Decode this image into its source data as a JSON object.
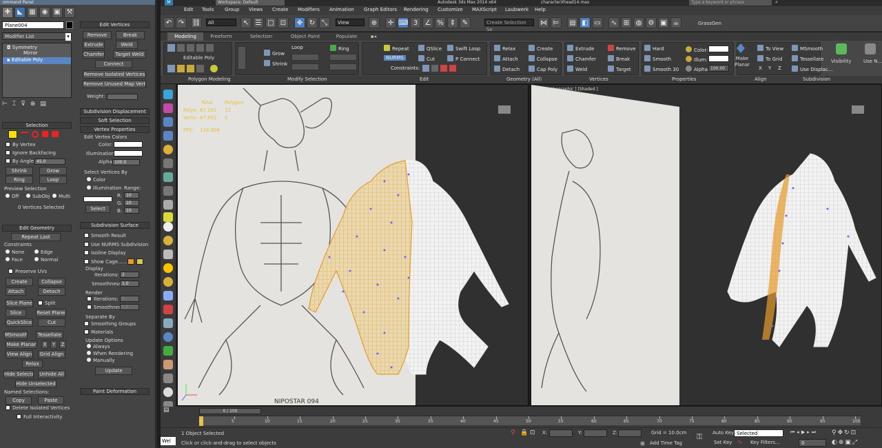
{
  "app": {
    "title": "Autodesk 3ds Max  2014 x64",
    "workspace": "Workspace: Default",
    "file": "characterXhead14.max",
    "search_placeholder": "Type a keyword or phrase"
  },
  "menubar": [
    "Edit",
    "Tools",
    "Group",
    "Views",
    "Create",
    "Modifiers",
    "Animation",
    "Graph Editors",
    "Rendering",
    "Customize",
    "MAXScript",
    "Laubwerk",
    "Help"
  ],
  "cmdpanel": {
    "title": "ommand Panel",
    "object_name": "Plane004",
    "modifier_list": "Modifier List",
    "stack": [
      "Symmetry",
      "Mirror",
      "Editable Poly"
    ],
    "edit_vertices": {
      "header": "Edit Vertices",
      "remove": "Remove",
      "break": "Break",
      "extrude": "Extrude",
      "weld": "Weld",
      "chamfer": "Chamfer",
      "target_weld": "Target Weld",
      "connect": "Connect",
      "remove_isolated": "Remove Isolated Vertices",
      "remove_unused": "Remove Unused Map Verts",
      "weight": "Weight:"
    },
    "subdiv_displacement": "Subdivision Displacement",
    "soft_selection": "Soft Selection",
    "vertex_props": {
      "header": "Vertex Properties",
      "edit_colors": "Edit Vertex Colors",
      "color": "Color:",
      "illumination": "Illumination:",
      "alpha": "Alpha:",
      "alpha_val": "100.0",
      "select_by": "Select Vertices By",
      "opt_color": "Color",
      "opt_illum": "Illumination",
      "range": "Range:",
      "r": "R:",
      "g": "G:",
      "b": "B:",
      "r_val": "10",
      "g_val": "10",
      "b_val": "10",
      "select": "Select"
    },
    "subdiv_surface": {
      "header": "Subdivision Surface",
      "smooth_result": "Smooth Result",
      "use_nurms": "Use NURMS Subdivision",
      "isoline": "Isoline Display",
      "show_cage": "Show Cage......",
      "display": "Display",
      "iterations": "Iterations:",
      "iter_val": "2",
      "smoothness": "Smoothness:",
      "smooth_val": "1.0",
      "render": "Render",
      "r_iterations": "Iterations:",
      "r_iter_val": "0",
      "r_smoothness": "Smoothness:",
      "r_smooth_val": "1.0",
      "separate_by": "Separate By",
      "smoothing_groups": "Smoothing Groups",
      "materials": "Materials",
      "update_options": "Update Options",
      "always": "Always",
      "when_rendering": "When Rendering",
      "manually": "Manually",
      "update": "Update"
    },
    "paint_deformation": "Paint Deformation",
    "selection": {
      "header": "Selection",
      "by_vertex": "By Vertex",
      "ignore_backfacing": "Ignore Backfacing",
      "by_angle": "By Angle:",
      "angle_val": "45.0",
      "shrink": "Shrink",
      "grow": "Grow",
      "ring": "Ring",
      "loop": "Loop",
      "preview": "Preview Selection",
      "off": "Off",
      "subobj": "SubObj",
      "multi": "Multi",
      "status": "0 Vertices Selected"
    },
    "edit_geometry": {
      "header": "Edit Geometry",
      "repeat_last": "Repeat Last",
      "constraints": "Constraints",
      "none": "None",
      "edge": "Edge",
      "face": "Face",
      "normal": "Normal",
      "preserve_uvs": "Preserve UVs",
      "create": "Create",
      "collapse": "Collapse",
      "attach": "Attach",
      "detach": "Detach",
      "slice_plane": "Slice Plane",
      "split": "Split",
      "slice": "Slice",
      "reset_plane": "Reset Plane",
      "quickslice": "QuickSlice",
      "cut": "Cut",
      "msmooth": "MSmooth",
      "tessellate": "Tessellate",
      "make_planar": "Make Planar",
      "x": "X",
      "y": "Y",
      "z": "Z",
      "view_align": "View Align",
      "grid_align": "Grid Align",
      "relax": "Relax",
      "hide_selected": "Hide Selected",
      "unhide_all": "Unhide All",
      "hide_unselected": "Hide Unselected",
      "named_sel": "Named Selections:",
      "copy": "Copy",
      "paste": "Paste",
      "delete_isolated": "Delete Isolated Vertices",
      "full_interactivity": "Full Interactivity"
    }
  },
  "maintool": {
    "filter": "All",
    "refcoord": "View",
    "selset": "Create Selection Se",
    "grassgen": "GrassGen"
  },
  "ribbon_tabs": [
    "Modeling",
    "Freeform",
    "Selection",
    "Object Paint",
    "Populate"
  ],
  "ribbon": {
    "editable_poly": "Editable Poly",
    "grow": "Grow",
    "shrink": "Shrink",
    "loop": "Loop",
    "ring": "Ring",
    "repeat": "Repeat",
    "qslice": "QSlice",
    "swift_loop": "Swift Loop",
    "nurms": "NURMS",
    "cut": "Cut",
    "p_connect": "P Connect",
    "constraints": "Constraints:",
    "relax": "Relax",
    "create": "Create",
    "attach": "Attach",
    "collapse": "Collapse",
    "detach": "Detach",
    "cap_poly": "Cap Poly",
    "extrude": "Extrude",
    "remove": "Remove",
    "chamfer": "Chamfer",
    "break": "Break",
    "weld": "Weld",
    "target": "Target",
    "hard": "Hard",
    "smooth": "Smooth",
    "smooth30": "Smooth 30",
    "color": "Color:",
    "illum": "Illum:",
    "alpha": "Alpha:",
    "alpha_val": "100.00",
    "make_planar": "Make Planar",
    "to_view": "To View",
    "to_grid": "To Grid",
    "x": "X",
    "y": "Y",
    "z": "Z",
    "msmooth": "MSmooth",
    "tessellate": "Tessellate",
    "use_displace": "Use Displac...",
    "visibility": "Visibility",
    "use_n": "Use N...",
    "groups": [
      "Polygon Modeling",
      "Modify Selection",
      "Edit",
      "Geometry (All)",
      "Vertices",
      "Properties",
      "Align",
      "Subdivision"
    ]
  },
  "vp1": {
    "stats": {
      "total": "Total",
      "polys_l": "Polys:",
      "polys_v": "67,181",
      "verts_l": "Verts:",
      "verts_v": "67,692",
      "polys_sel": "12",
      "verts_sel": "0",
      "fps_l": "FPS:",
      "fps_v": "128.908",
      "polygon_label": "Polygon"
    },
    "signature": "NIPOSTAR 094"
  },
  "vp2": {
    "label": "[ + ] [Orthographic ] [Shaded ]"
  },
  "timeline": {
    "frame": "0 / 100",
    "ticks": [
      "0",
      "5",
      "10",
      "15",
      "20",
      "25",
      "30",
      "35",
      "40",
      "45",
      "50",
      "55",
      "60",
      "65",
      "70",
      "75",
      "80",
      "85",
      "90",
      "95",
      "100"
    ]
  },
  "status": {
    "objects": "1 Object Selected",
    "prompt": "Click or click-and-drag to select objects",
    "welcome": "Wel",
    "x": "X:",
    "y": "Y:",
    "z": "Z:",
    "grid": "Grid = 10.0cm",
    "add_time_tag": "Add Time Tag",
    "auto_key": "Auto Key",
    "set_key": "Set Key",
    "selected": "Selected",
    "key_filters": "Key Filters...",
    "frame_val": "0"
  },
  "colors": {
    "accent": "#5b86c4",
    "selection_yellow": "#ffe000",
    "cage_orange": "#e69a2a",
    "vertex_purple": "#7060ff"
  }
}
